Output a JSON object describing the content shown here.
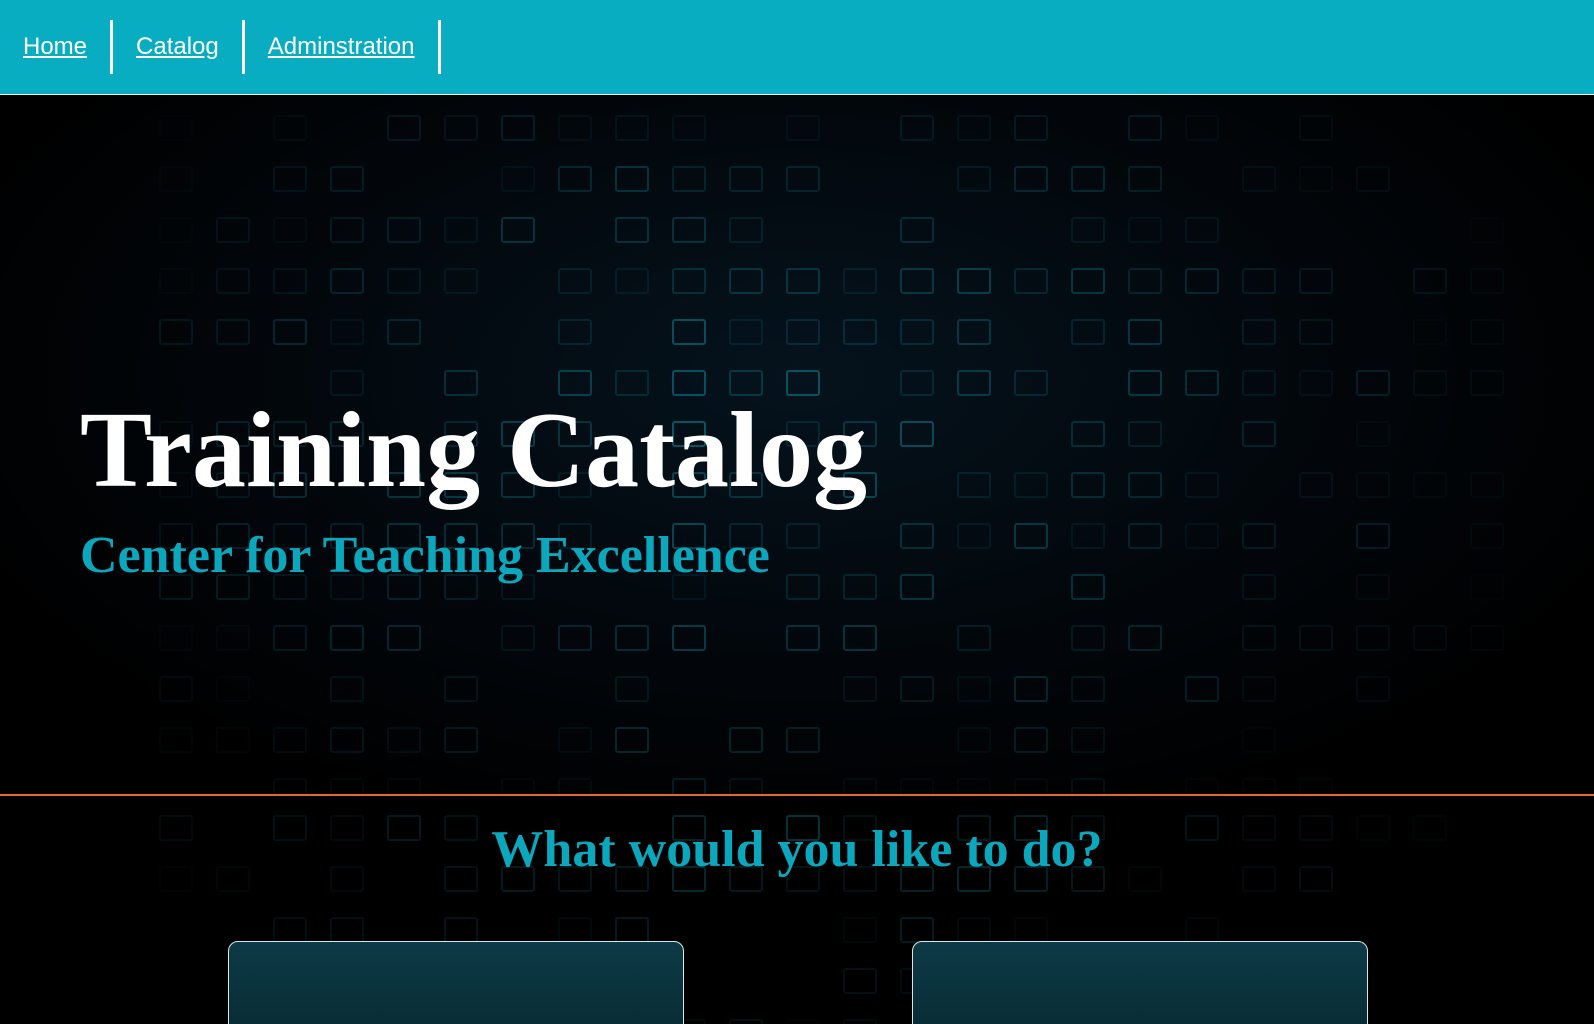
{
  "nav": {
    "items": [
      {
        "label": "Home"
      },
      {
        "label": "Catalog"
      },
      {
        "label": "Adminstration"
      }
    ]
  },
  "hero": {
    "title": "Training Catalog",
    "subtitle": "Center for Teaching Excellence"
  },
  "prompt": {
    "heading": "What would you like to do?"
  },
  "colors": {
    "nav_background": "#08adc2",
    "accent_teal": "#0aa7bd",
    "divider_orange": "#e46a2a",
    "page_background": "#000000"
  }
}
